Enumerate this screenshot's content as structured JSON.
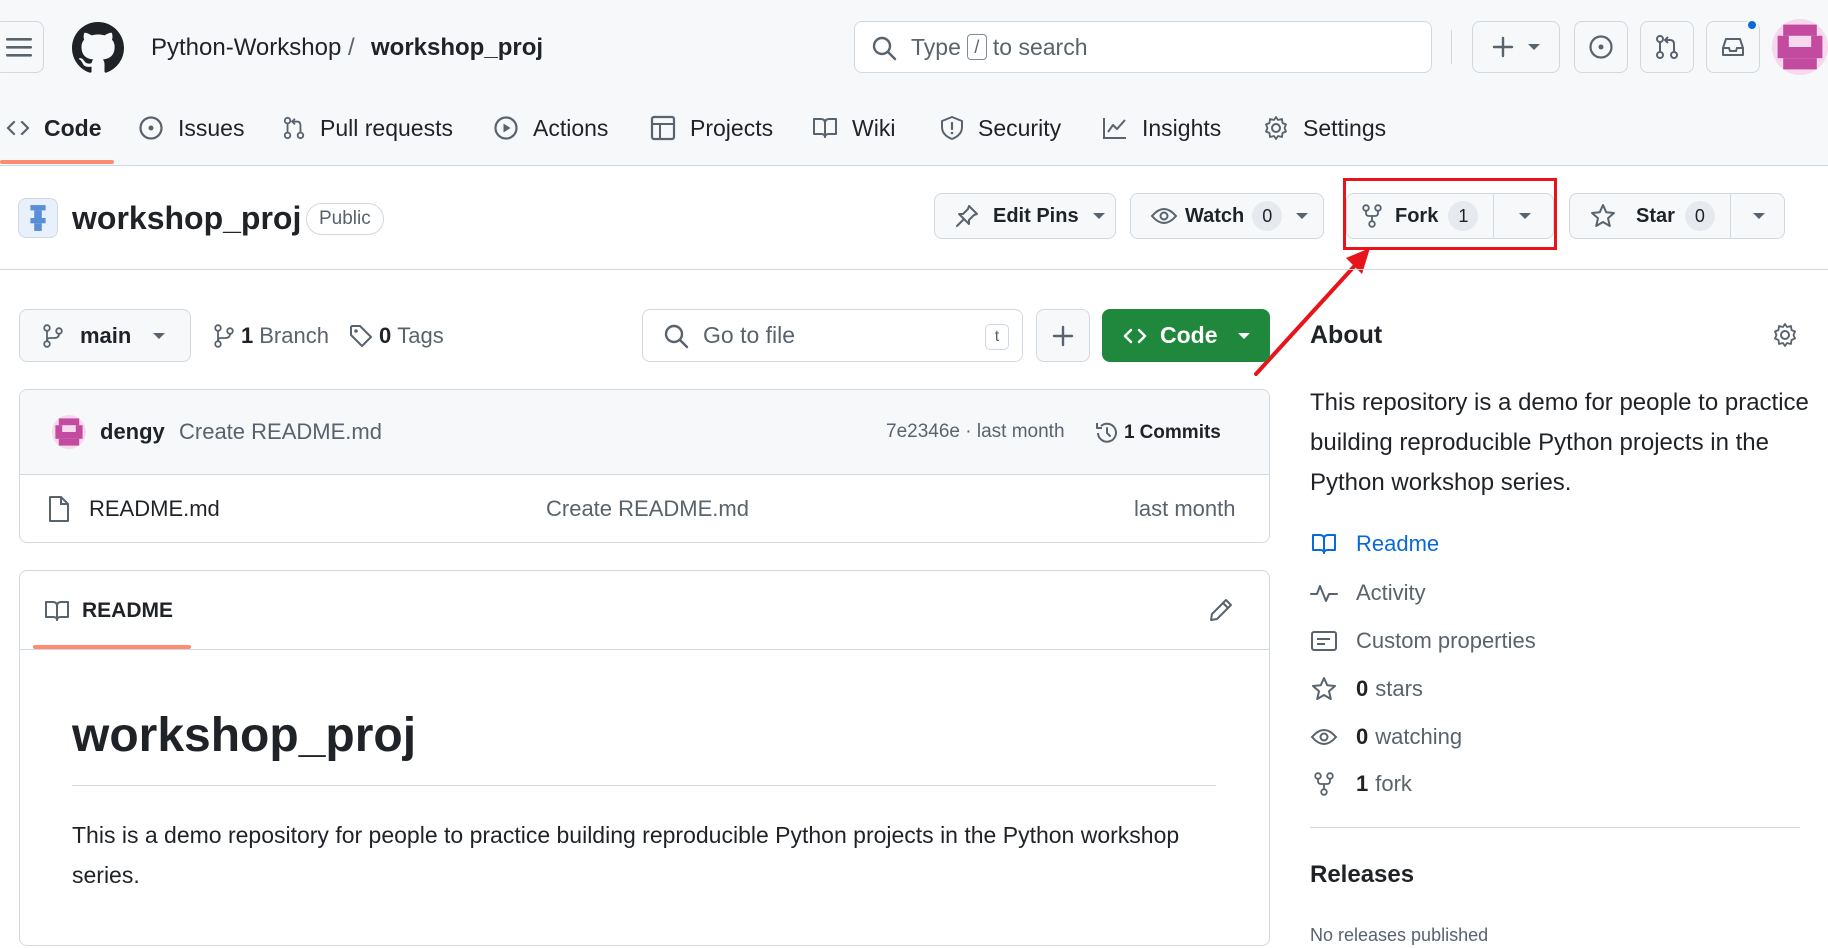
{
  "header": {
    "owner": "Python-Workshop",
    "separator": "/",
    "repo": "workshop_proj",
    "search_prefix": "Type",
    "search_key": "/",
    "search_suffix": "to search"
  },
  "tabs": [
    {
      "label": "Code"
    },
    {
      "label": "Issues"
    },
    {
      "label": "Pull requests"
    },
    {
      "label": "Actions"
    },
    {
      "label": "Projects"
    },
    {
      "label": "Wiki"
    },
    {
      "label": "Security"
    },
    {
      "label": "Insights"
    },
    {
      "label": "Settings"
    }
  ],
  "repo_header": {
    "name": "workshop_proj",
    "visibility": "Public",
    "edit_pins": "Edit Pins",
    "watch": "Watch",
    "watch_count": "0",
    "fork": "Fork",
    "fork_count": "1",
    "star": "Star",
    "star_count": "0"
  },
  "toolbar": {
    "branch": "main",
    "branch_count": "1",
    "branch_label": "Branch",
    "tag_count": "0",
    "tag_label": "Tags",
    "goto_placeholder": "Go to file",
    "goto_key": "t",
    "code_button": "Code"
  },
  "commit": {
    "author": "dengy",
    "message": "Create README.md",
    "hash_time": "7e2346e · last month",
    "commits_count": "1",
    "commits_label": "Commits"
  },
  "files": [
    {
      "name": "README.md",
      "message": "Create README.md",
      "time": "last month"
    }
  ],
  "readme": {
    "tab_label": "README",
    "heading": "workshop_proj",
    "body": "This is a demo repository for people to practice building reproducible Python projects in the Python workshop series."
  },
  "about": {
    "title": "About",
    "description": "This repository is a demo for people to practice building reproducible Python projects in the Python workshop series.",
    "readme": "Readme",
    "activity": "Activity",
    "custom_properties": "Custom properties",
    "stars_count": "0",
    "stars_label": "stars",
    "watching_count": "0",
    "watching_label": "watching",
    "fork_count": "1",
    "fork_label": "fork"
  },
  "releases": {
    "title": "Releases",
    "empty": "No releases published"
  },
  "colors": {
    "accent_orange": "#fd8c73",
    "primary_green": "#1f883d",
    "link_blue": "#0969da",
    "annotation_red": "#e8141c",
    "notification_blue": "#0969da"
  }
}
